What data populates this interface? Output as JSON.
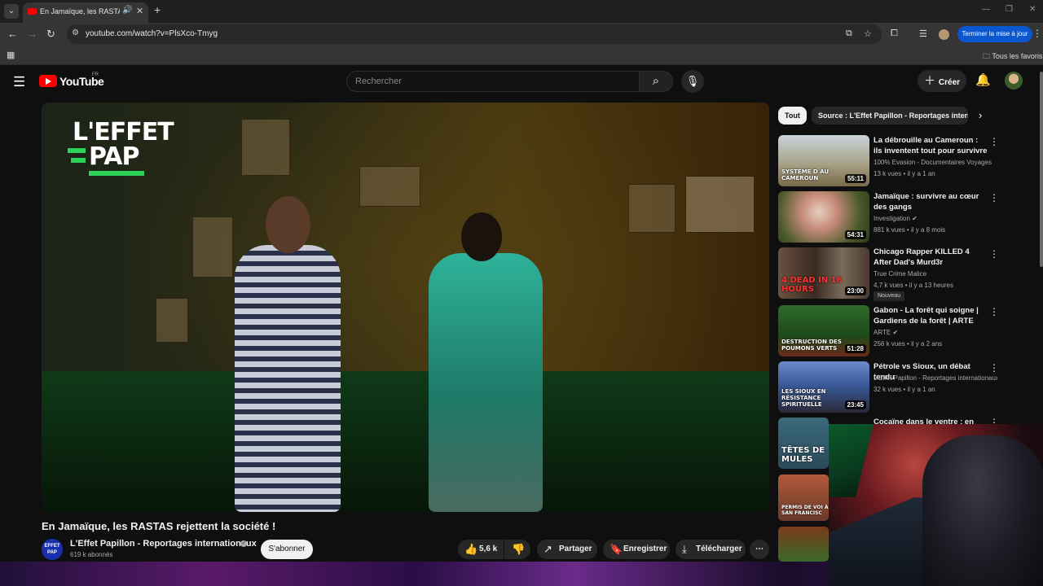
{
  "browser": {
    "tab_title": "En Jamaïque, les RASTAS re",
    "url": "youtube.com/watch?v=PlsXco-Tmyg",
    "update_button": "Terminer la mise à jour",
    "bookmarks_all": "Tous les favoris"
  },
  "header": {
    "logo_text": "YouTube",
    "country": "FR",
    "search_placeholder": "Rechercher",
    "create_label": "Créer"
  },
  "player": {
    "logo_line1": "L'EFFET",
    "logo_line2": "PAP"
  },
  "video": {
    "title": "En Jamaïque, les RASTAS rejettent la société !",
    "channel_name": "L'Effet Papillon - Reportages internationaux",
    "channel_avatar_text": "EFFET PAP",
    "subscribers": "619 k abonnés",
    "subscribe_label": "S'abonner",
    "likes": "5,6 k",
    "share_label": "Partager",
    "save_label": "Enregistrer",
    "download_label": "Télécharger"
  },
  "sidebar": {
    "chips": [
      "Tout",
      "Source : L'Effet Papillon - Reportages internationaux"
    ],
    "items": [
      {
        "title": "La débrouille au Cameroun : ils inventent tout pour survivre",
        "channel": "100% Evasion - Documentaires Voyages",
        "meta": "13 k vues • il y a 1 an",
        "duration": "55:11",
        "thumb_text": "SYSTÈME D AU CAMEROUN"
      },
      {
        "title": "Jamaïque : survivre au cœur des gangs",
        "channel": "Investigation",
        "meta": "881 k vues • il y a 8 mois",
        "duration": "54:31",
        "thumb_text": ""
      },
      {
        "title": "Chicago Rapper KILLED 4 After Dad's Murd3r",
        "channel": "True Crime Malice",
        "meta": "4,7 k vues • il y a 13 heures",
        "duration": "23:00",
        "badge": "Nouveau",
        "thumb_text": "4 DEAD IN 16 HOURS"
      },
      {
        "title": "Gabon - La forêt qui soigne | Gardiens de la forêt | ARTE",
        "channel": "ARTE",
        "meta": "256 k vues • il y a 2 ans",
        "duration": "51:28",
        "thumb_text": "DESTRUCTION DES POUMONS VERTS"
      },
      {
        "title": "Pétrole vs Sioux, un débat tendu",
        "channel": "L'Effet Papillon - Reportages internationaux",
        "meta": "32 k vues • il y a 1 an",
        "duration": "23:45",
        "thumb_text": "LES SIOUX EN RÉSISTANCE SPIRITUELLE"
      },
      {
        "title": "Cocaïne dans le ventre : en",
        "thumb_text": "TÊTES DE MULES"
      }
    ],
    "small_thumb_texts": [
      "PERMIS DE VOI À SAN FRANCISC"
    ]
  },
  "icons": {
    "accent_red": "#ff0000",
    "update_blue": "#0b57d0",
    "effet_green": "#2bd35a"
  }
}
